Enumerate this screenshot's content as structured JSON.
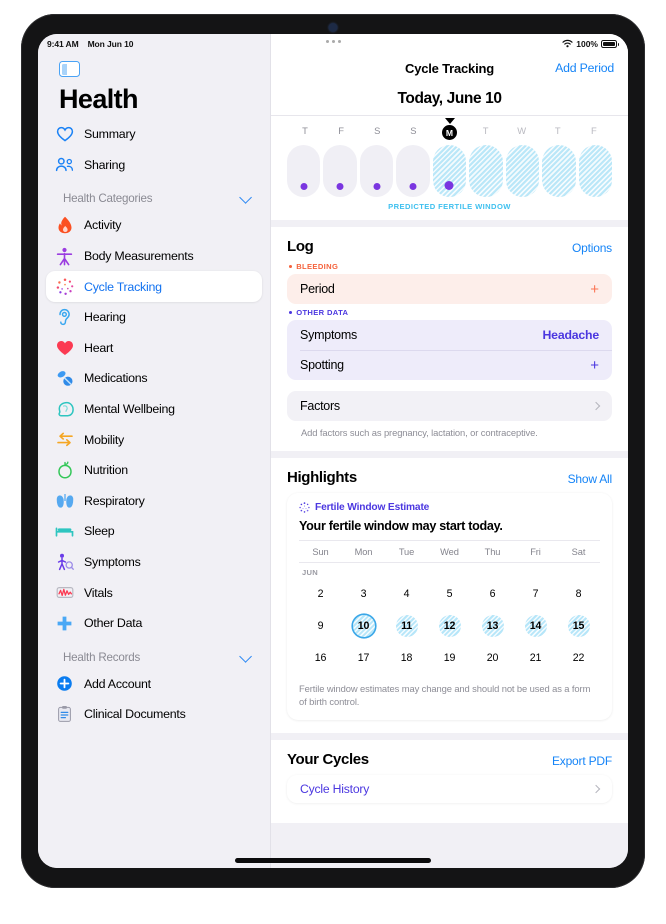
{
  "statusbar": {
    "time": "9:41 AM",
    "date": "Mon Jun 10",
    "battery_percent": "100%",
    "wifi_icon": "wifi-icon",
    "battery_icon": "battery-full-icon"
  },
  "sidebar": {
    "toggle_icon": "sidebar-toggle-icon",
    "app_title": "Health",
    "top_items": [
      {
        "label": "Summary",
        "icon": "heart-outline-icon"
      },
      {
        "label": "Sharing",
        "icon": "two-people-icon"
      }
    ],
    "groups": [
      {
        "label": "Health Categories",
        "chevron_icon": "chevron-down-icon",
        "items": [
          {
            "label": "Activity",
            "icon": "flame-icon"
          },
          {
            "label": "Body Measurements",
            "icon": "body-figure-icon"
          },
          {
            "label": "Cycle Tracking",
            "icon": "cycle-dots-icon",
            "selected": true
          },
          {
            "label": "Hearing",
            "icon": "ear-icon"
          },
          {
            "label": "Heart",
            "icon": "heart-filled-icon"
          },
          {
            "label": "Medications",
            "icon": "pills-icon"
          },
          {
            "label": "Mental Wellbeing",
            "icon": "head-brain-icon"
          },
          {
            "label": "Mobility",
            "icon": "arrows-mobility-icon"
          },
          {
            "label": "Nutrition",
            "icon": "apple-icon"
          },
          {
            "label": "Respiratory",
            "icon": "lungs-icon"
          },
          {
            "label": "Sleep",
            "icon": "bed-icon"
          },
          {
            "label": "Symptoms",
            "icon": "person-magnifier-icon"
          },
          {
            "label": "Vitals",
            "icon": "waveform-icon"
          },
          {
            "label": "Other Data",
            "icon": "plus-cross-icon"
          }
        ]
      },
      {
        "label": "Health Records",
        "chevron_icon": "chevron-down-icon",
        "items": [
          {
            "label": "Add Account",
            "icon": "plus-circle-icon"
          },
          {
            "label": "Clinical Documents",
            "icon": "clipboard-icon"
          }
        ]
      }
    ]
  },
  "detail": {
    "overflow_icon": "more-dots-icon",
    "navbar": {
      "title": "Cycle Tracking",
      "action": "Add Period"
    },
    "today": {
      "date_label": "Today, June 10",
      "marker_icon": "today-triangle-icon"
    },
    "cycle_strip": {
      "caption": "PREDICTED FERTILE WINDOW",
      "days": [
        {
          "dow": "T",
          "past": true,
          "fertile": false,
          "dot": true,
          "today": false
        },
        {
          "dow": "F",
          "past": true,
          "fertile": false,
          "dot": true,
          "today": false
        },
        {
          "dow": "S",
          "past": true,
          "fertile": false,
          "dot": true,
          "today": false
        },
        {
          "dow": "S",
          "past": true,
          "fertile": false,
          "dot": true,
          "today": false
        },
        {
          "dow": "M",
          "past": false,
          "fertile": true,
          "dot": true,
          "today": true
        },
        {
          "dow": "T",
          "past": false,
          "fertile": true,
          "dot": false,
          "today": false
        },
        {
          "dow": "W",
          "past": false,
          "fertile": true,
          "dot": false,
          "today": false
        },
        {
          "dow": "T",
          "past": false,
          "fertile": true,
          "dot": false,
          "today": false
        },
        {
          "dow": "F",
          "past": false,
          "fertile": true,
          "dot": false,
          "today": false
        }
      ]
    },
    "log": {
      "title": "Log",
      "action": "Options",
      "bleeding_label": "BLEEDING",
      "bleeding_rows": [
        {
          "name": "Period",
          "value": "",
          "accessory": "plus"
        }
      ],
      "other_label": "OTHER DATA",
      "other_rows": [
        {
          "name": "Symptoms",
          "value": "Headache",
          "accessory": "value"
        },
        {
          "name": "Spotting",
          "value": "",
          "accessory": "plus"
        }
      ],
      "factors_row": {
        "name": "Factors",
        "accessory": "chevron"
      },
      "factors_helper": "Add factors such as pregnancy, lactation, or contraceptive."
    },
    "highlights": {
      "title": "Highlights",
      "action": "Show All",
      "card": {
        "kicker_icon": "cycle-dots-small-icon",
        "kicker": "Fertile Window Estimate",
        "headline": "Your fertile window may start today.",
        "weekday_headers": [
          "Sun",
          "Mon",
          "Tue",
          "Wed",
          "Thu",
          "Fri",
          "Sat"
        ],
        "month_label": "JUN",
        "weeks": [
          [
            {
              "day": "2",
              "fertile": false,
              "today": false
            },
            {
              "day": "3",
              "fertile": false,
              "today": false
            },
            {
              "day": "4",
              "fertile": false,
              "today": false
            },
            {
              "day": "5",
              "fertile": false,
              "today": false
            },
            {
              "day": "6",
              "fertile": false,
              "today": false
            },
            {
              "day": "7",
              "fertile": false,
              "today": false
            },
            {
              "day": "8",
              "fertile": false,
              "today": false
            }
          ],
          [
            {
              "day": "9",
              "fertile": false,
              "today": false
            },
            {
              "day": "10",
              "fertile": true,
              "today": true
            },
            {
              "day": "11",
              "fertile": true,
              "today": false
            },
            {
              "day": "12",
              "fertile": true,
              "today": false
            },
            {
              "day": "13",
              "fertile": true,
              "today": false
            },
            {
              "day": "14",
              "fertile": true,
              "today": false
            },
            {
              "day": "15",
              "fertile": true,
              "today": false
            }
          ],
          [
            {
              "day": "16",
              "fertile": false,
              "today": false
            },
            {
              "day": "17",
              "fertile": false,
              "today": false
            },
            {
              "day": "18",
              "fertile": false,
              "today": false
            },
            {
              "day": "19",
              "fertile": false,
              "today": false
            },
            {
              "day": "20",
              "fertile": false,
              "today": false
            },
            {
              "day": "21",
              "fertile": false,
              "today": false
            },
            {
              "day": "22",
              "fertile": false,
              "today": false
            }
          ]
        ],
        "note": "Fertile window estimates may change and should not be used as a form of birth control."
      }
    },
    "your_cycles": {
      "title": "Your Cycles",
      "action": "Export PDF",
      "rows": [
        {
          "label": "Cycle History",
          "accessory": "chevron"
        }
      ]
    }
  },
  "colors": {
    "accent_blue": "#1584f7",
    "accent_purple": "#4b37e0",
    "bleeding_red": "#f5623c",
    "fertile_cyan": "#3fc0ef",
    "fertile_fill": "#b6e6f9",
    "sidebar_bg": "#f1f0f5"
  }
}
